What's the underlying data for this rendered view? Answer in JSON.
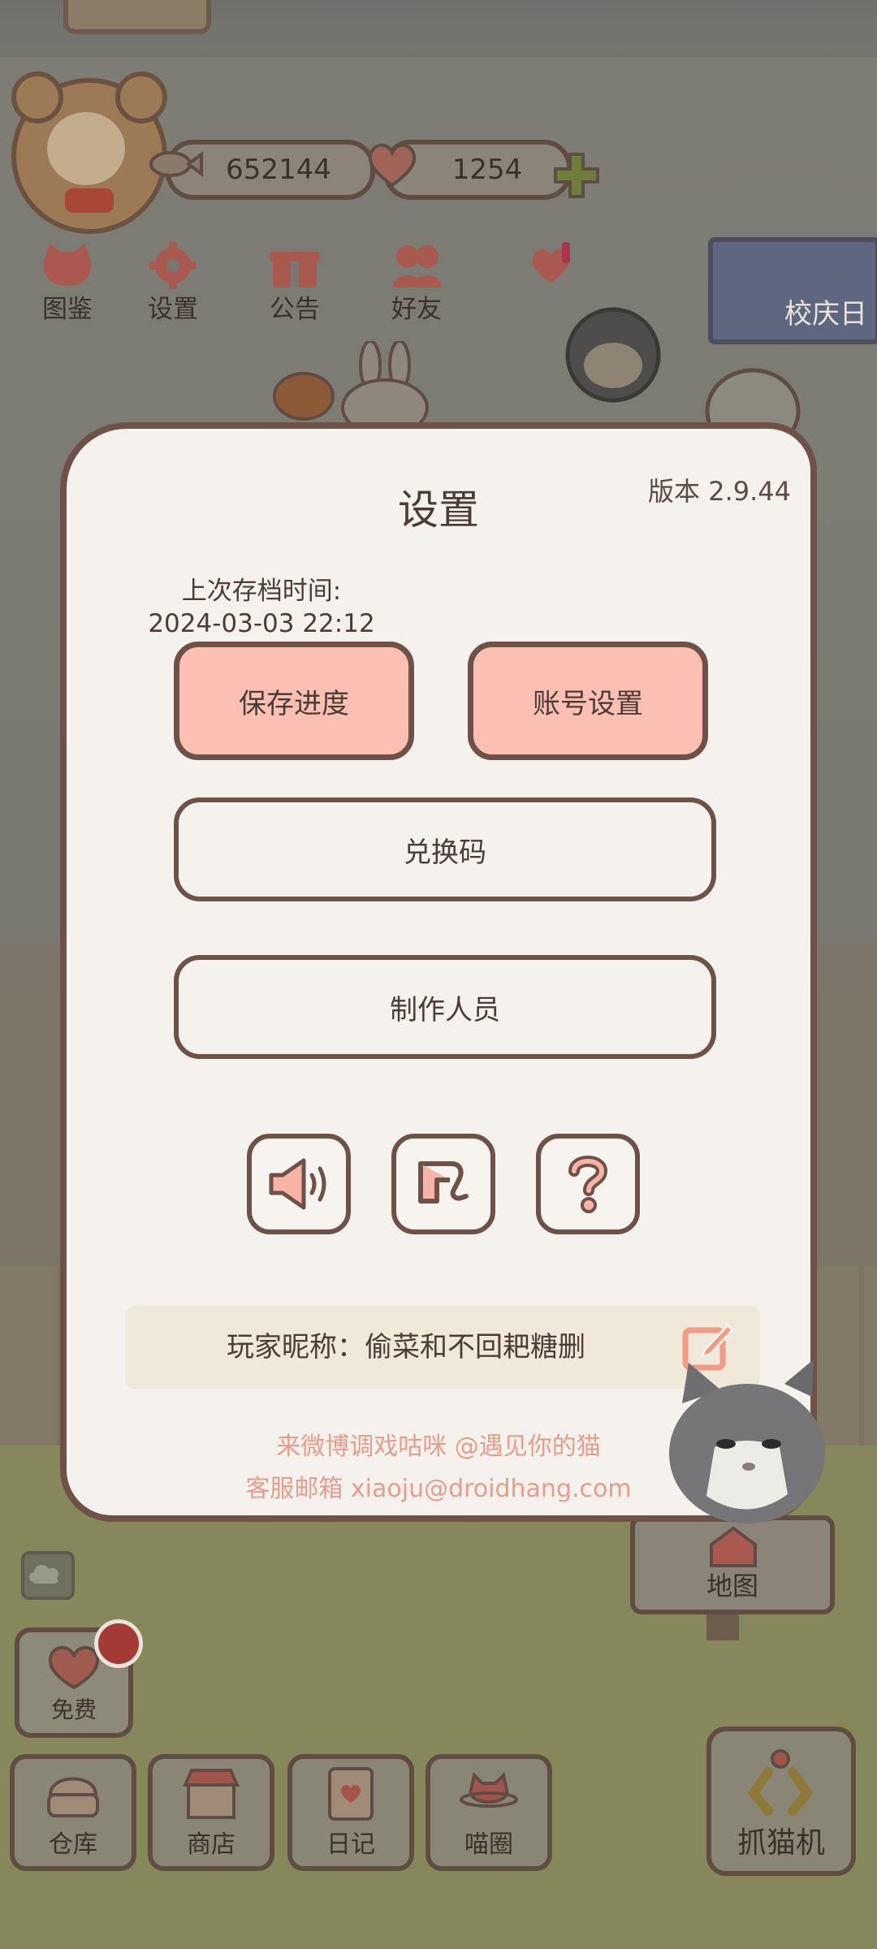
{
  "hud": {
    "fish_count": "652144",
    "heart_count": "1254"
  },
  "top_nav": [
    {
      "label": "图鉴",
      "icon": "cat-face-icon"
    },
    {
      "label": "设置",
      "icon": "gear-icon"
    },
    {
      "label": "公告",
      "icon": "gift-icon"
    },
    {
      "label": "好友",
      "icon": "friends-icon"
    },
    {
      "label": "",
      "icon": "hearts-icon"
    }
  ],
  "event": {
    "label": "校庆日"
  },
  "settings": {
    "title": "设置",
    "version": "版本 2.9.44",
    "last_save_label": "上次存档时间:",
    "last_save_time": "2024-03-03 22:12",
    "save_button": "保存进度",
    "account_button": "账号设置",
    "redeem_button": "兑换码",
    "credits_button": "制作人员",
    "icon_buttons": [
      "sound-icon",
      "music-note-icon",
      "help-icon"
    ],
    "nickname_text": "玩家昵称：偷菜和不回耙糖删",
    "footer_weibo": "来微博调戏咕咪 @遇见你的猫",
    "footer_email": "客服邮箱 xiaoju@droidhang.com"
  },
  "free_button": {
    "label": "免费"
  },
  "map_sign": {
    "label": "地图"
  },
  "bottom_bar": [
    {
      "label": "仓库",
      "icon": "storage-icon"
    },
    {
      "label": "商店",
      "icon": "shop-icon"
    },
    {
      "label": "日记",
      "icon": "diary-icon"
    },
    {
      "label": "喵圈",
      "icon": "cat-planet-icon"
    }
  ],
  "claw_machine": {
    "label": "抓猫机"
  },
  "colors": {
    "modal_bg": "#f5f2ee",
    "modal_border": "#6e5147",
    "pink_button": "#fbc0b3",
    "accent_text": "#e59e8c",
    "nickname_bar": "#f0e8d8"
  }
}
